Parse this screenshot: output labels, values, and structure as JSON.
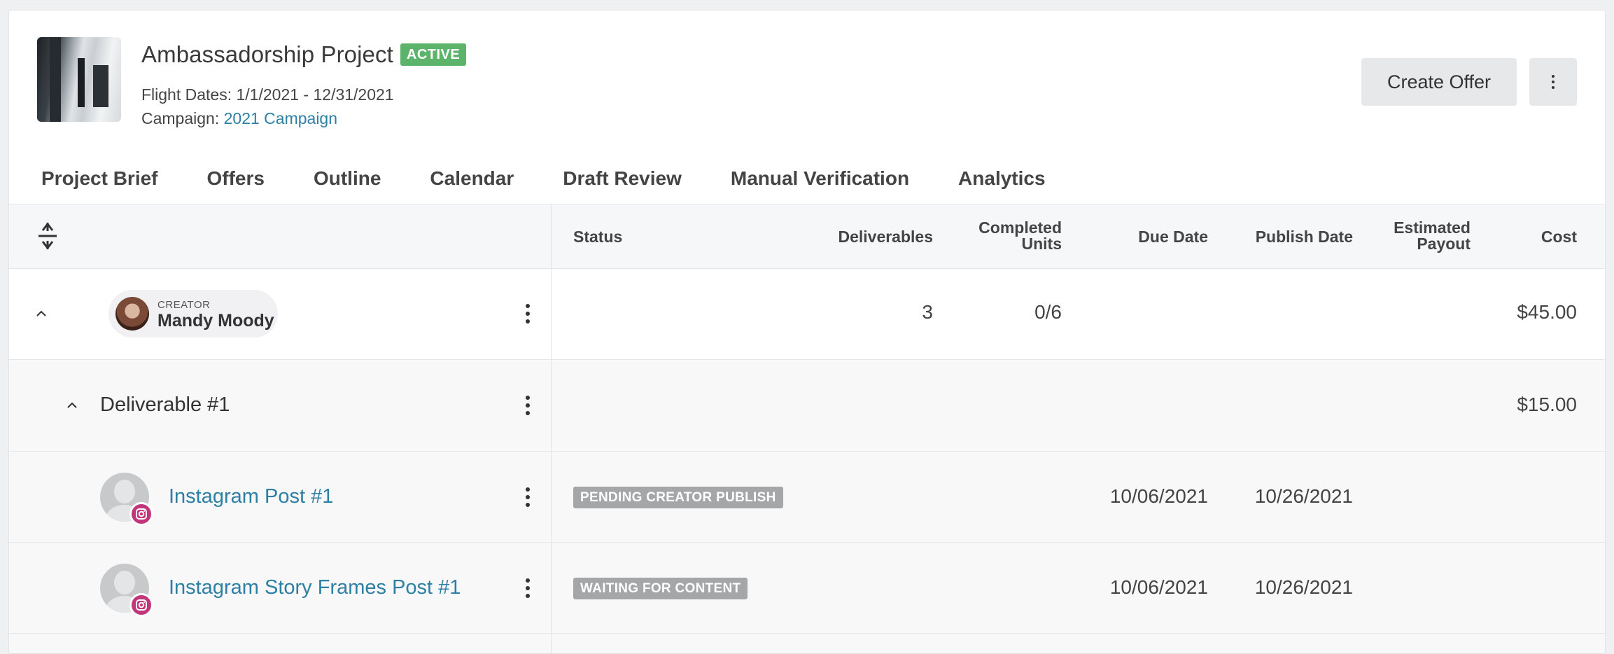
{
  "header": {
    "project_title": "Ambassadorship Project",
    "status_badge": "ACTIVE",
    "flight_dates_label": "Flight Dates:",
    "flight_dates_value": "1/1/2021 - 12/31/2021",
    "campaign_label": "Campaign:",
    "campaign_link": "2021 Campaign",
    "create_offer_label": "Create Offer",
    "more_icon": "vertical-ellipsis-icon"
  },
  "tabs": [
    {
      "label": "Project Brief",
      "active": false
    },
    {
      "label": "Offers",
      "active": false
    },
    {
      "label": "Outline",
      "active": true
    },
    {
      "label": "Calendar",
      "active": false
    },
    {
      "label": "Draft Review",
      "active": false
    },
    {
      "label": "Manual Verification",
      "active": false
    },
    {
      "label": "Analytics",
      "active": false
    }
  ],
  "table": {
    "columns": {
      "status": "Status",
      "deliverables": "Deliverables",
      "completed_units_1": "Completed",
      "completed_units_2": "Units",
      "due_date": "Due Date",
      "publish_date": "Publish Date",
      "estimated_payout_1": "Estimated",
      "estimated_payout_2": "Payout",
      "cost": "Cost"
    },
    "creator_row": {
      "label": "CREATOR",
      "name": "Mandy Moody",
      "deliverables": "3",
      "completed_units": "0/6",
      "cost": "$45.00"
    },
    "deliverable_row": {
      "title": "Deliverable #1",
      "cost": "$15.00"
    },
    "posts": [
      {
        "title": "Instagram Post #1",
        "status": "PENDING CREATOR PUBLISH",
        "due_date": "10/06/2021",
        "publish_date": "10/26/2021",
        "platform_icon": "instagram-icon"
      },
      {
        "title": "Instagram Story Frames Post #1",
        "status": "WAITING FOR CONTENT",
        "due_date": "10/06/2021",
        "publish_date": "10/26/2021",
        "platform_icon": "instagram-icon"
      }
    ]
  },
  "colors": {
    "accent_link": "#2e7fa4",
    "active_badge": "#5cb36a",
    "tab_underline": "#2b2460",
    "status_tag": "#a5a6a8",
    "instagram": "#c1357b"
  }
}
